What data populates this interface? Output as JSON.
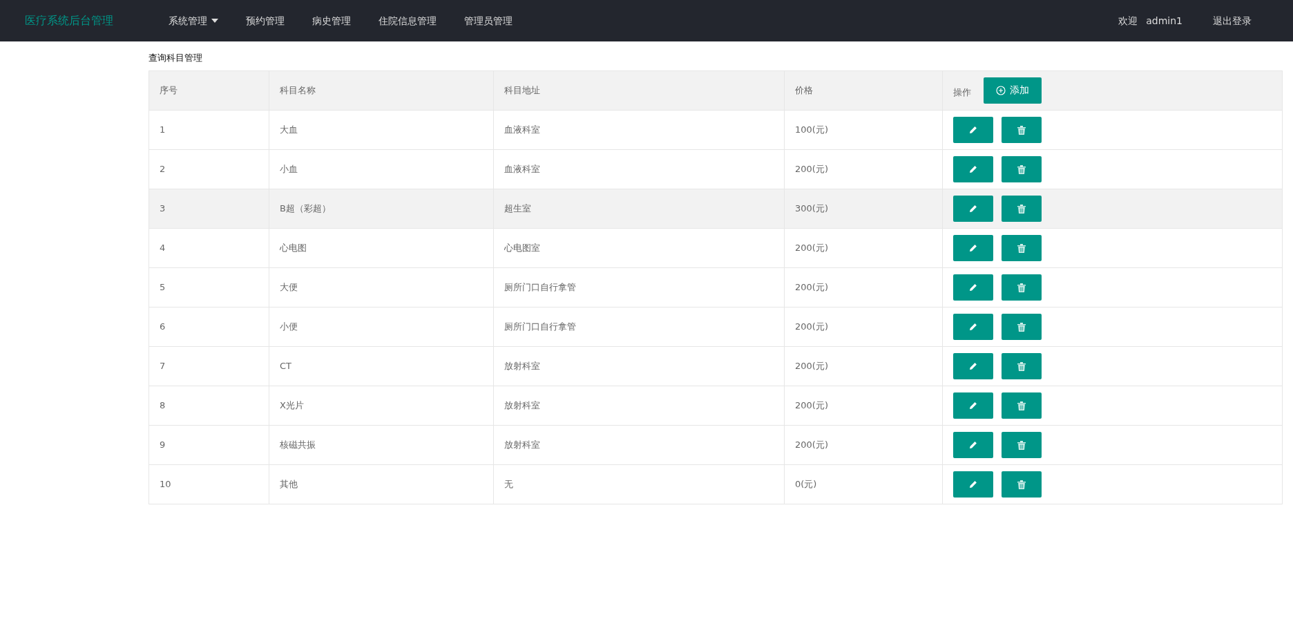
{
  "navbar": {
    "brand": "医疗系统后台管理",
    "menu": [
      {
        "label": "系统管理",
        "dropdown": true
      },
      {
        "label": "预约管理",
        "dropdown": false
      },
      {
        "label": "病史管理",
        "dropdown": false
      },
      {
        "label": "住院信息管理",
        "dropdown": false
      },
      {
        "label": "管理员管理",
        "dropdown": false
      }
    ],
    "welcome": "欢迎",
    "user": "admin1",
    "logout": "退出登录"
  },
  "page_title": "查询科目管理",
  "table": {
    "columns": [
      "序号",
      "科目名称",
      "科目地址",
      "价格",
      "操作"
    ],
    "add_button": "添加",
    "rows": [
      {
        "cells": [
          "1",
          "大血",
          "血液科室",
          "100(元)"
        ],
        "highlighted": false
      },
      {
        "cells": [
          "2",
          "小血",
          "血液科室",
          "200(元)"
        ],
        "highlighted": false
      },
      {
        "cells": [
          "3",
          "B超（彩超）",
          "超生室",
          "300(元)"
        ],
        "highlighted": true
      },
      {
        "cells": [
          "4",
          "心电图",
          "心电图室",
          "200(元)"
        ],
        "highlighted": false
      },
      {
        "cells": [
          "5",
          "大便",
          "厕所门口自行拿管",
          "200(元)"
        ],
        "highlighted": false
      },
      {
        "cells": [
          "6",
          "小便",
          "厕所门口自行拿管",
          "200(元)"
        ],
        "highlighted": false
      },
      {
        "cells": [
          "7",
          "CT",
          "放射科室",
          "200(元)"
        ],
        "highlighted": false
      },
      {
        "cells": [
          "8",
          "X光片",
          "放射科室",
          "200(元)"
        ],
        "highlighted": false
      },
      {
        "cells": [
          "9",
          "核磁共振",
          "放射科室",
          "200(元)"
        ],
        "highlighted": false
      },
      {
        "cells": [
          "10",
          "其他",
          "无",
          "0(元)"
        ],
        "highlighted": false
      }
    ]
  }
}
